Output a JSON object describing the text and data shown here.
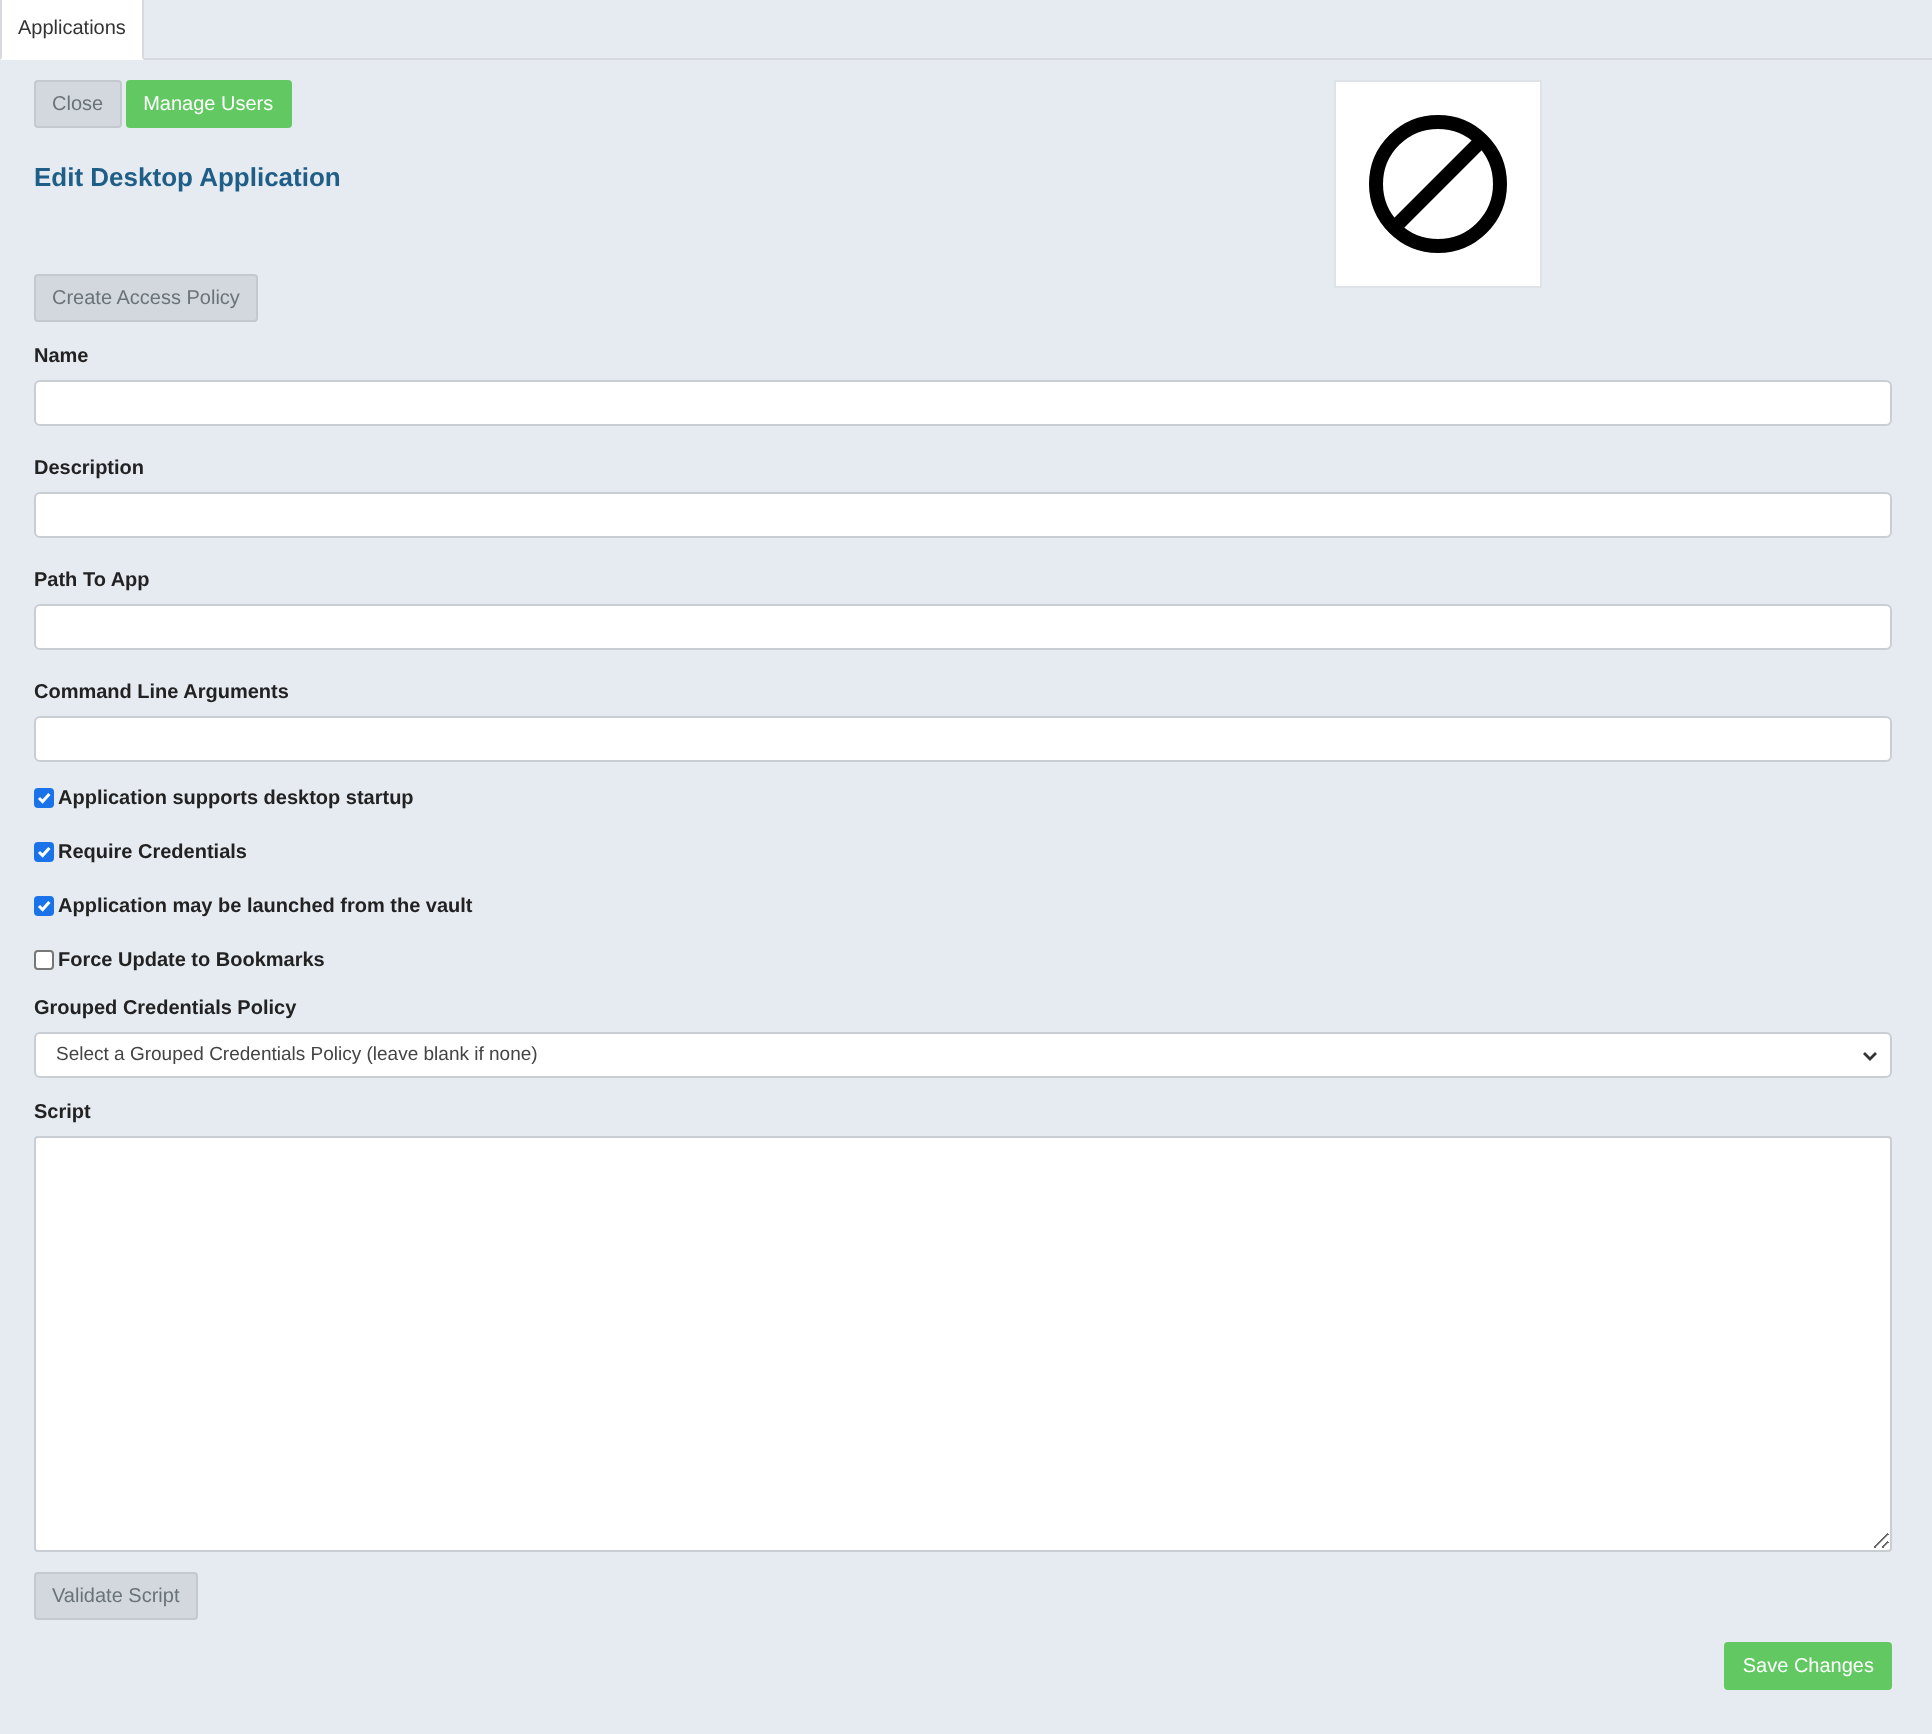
{
  "tabs": [
    {
      "label": "Applications",
      "selected": true
    }
  ],
  "toolbar_buttons": [
    {
      "label": "Close",
      "kind": "secondary"
    },
    {
      "label": "Manage Users",
      "kind": "primary"
    }
  ],
  "title": "Edit Desktop Application",
  "access_policy_button": {
    "label": "Create Access Policy",
    "kind": "secondary"
  },
  "fields": [
    {
      "label": "Name"
    },
    {
      "label": "Description"
    },
    {
      "label": "Path To App"
    },
    {
      "label": "Command Line Arguments"
    }
  ],
  "checkboxes": [
    {
      "label": "Application supports desktop startup",
      "checked": true
    },
    {
      "label": "Require Credentials",
      "checked": true
    },
    {
      "label": "Application may be launched from the vault",
      "checked": true
    },
    {
      "label": "Force Update to Bookmarks",
      "checked": false
    }
  ],
  "grouped_credentials_policy": {
    "label": "Grouped Credentials Policy",
    "value": "Select a Grouped Credentials Policy (leave blank if none)"
  },
  "script": {
    "label": "Script"
  },
  "validate_button": {
    "label": "Validate Script",
    "kind": "secondary"
  },
  "save_button": {
    "label": "Save Changes",
    "kind": "primary"
  }
}
